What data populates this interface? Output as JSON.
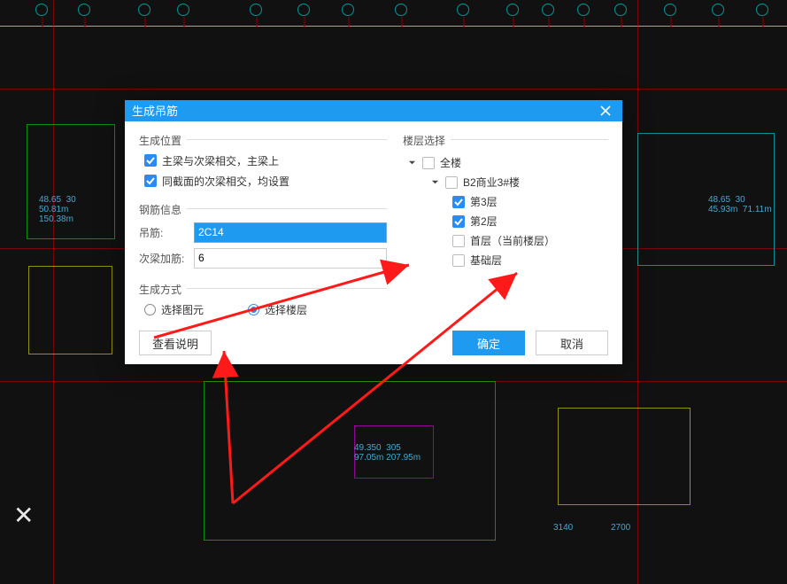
{
  "dialog": {
    "title": "生成吊筋",
    "groups": {
      "position": {
        "label": "生成位置",
        "opt1": "主梁与次梁相交，主梁上",
        "opt2": "同截面的次梁相交，均设置"
      },
      "rebar": {
        "label": "钢筋信息",
        "field1_label": "吊筋:",
        "field1_value": "2C14",
        "field2_label": "次梁加筋:",
        "field2_value": "6"
      },
      "method": {
        "label": "生成方式",
        "radio1": "选择图元",
        "radio2": "选择楼层"
      },
      "floors": {
        "label": "楼层选择",
        "tree": {
          "root": "全楼",
          "building": "B2商业3#楼",
          "items": [
            "第3层",
            "第2层",
            "首层（当前楼层）",
            "基础层"
          ]
        }
      }
    },
    "buttons": {
      "help": "查看说明",
      "ok": "确定",
      "cancel": "取消"
    }
  }
}
